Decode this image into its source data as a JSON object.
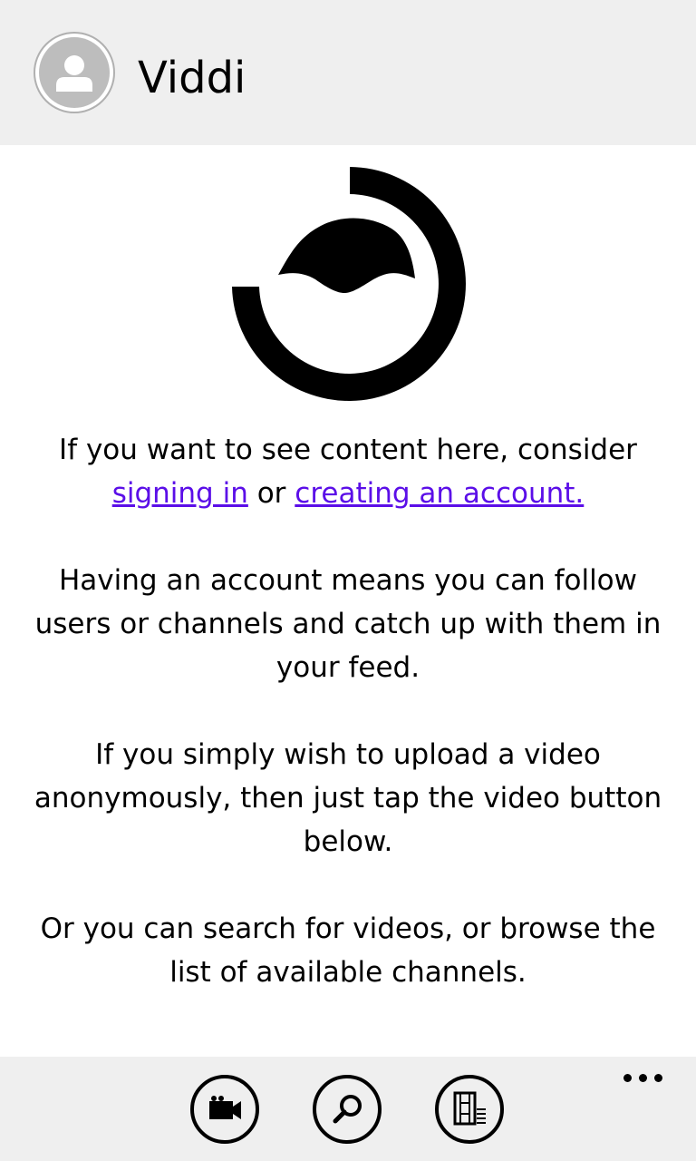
{
  "header": {
    "title": "Viddi",
    "avatar_icon": "user-icon"
  },
  "main": {
    "logo_icon": "viddi-logo",
    "intro_text": "If you want to see content here, consider",
    "sign_in_link": "signing in",
    "or_text": "or",
    "create_account_link": "creating an account.",
    "account_text": "Having an account means you can follow users or channels and catch up with them in your feed.",
    "upload_text": "If you simply wish to upload a video anonymously, then just tap the video button below.",
    "browse_text": "Or you can search for videos, or browse the list of available channels."
  },
  "appbar": {
    "buttons": [
      {
        "icon": "video-camera-icon"
      },
      {
        "icon": "search-icon"
      },
      {
        "icon": "channels-film-icon"
      }
    ],
    "more_icon": "more-ellipsis-icon"
  },
  "colors": {
    "link": "#5b0ee8",
    "header_bg": "#efefef",
    "appbar_bg": "#efefef"
  }
}
